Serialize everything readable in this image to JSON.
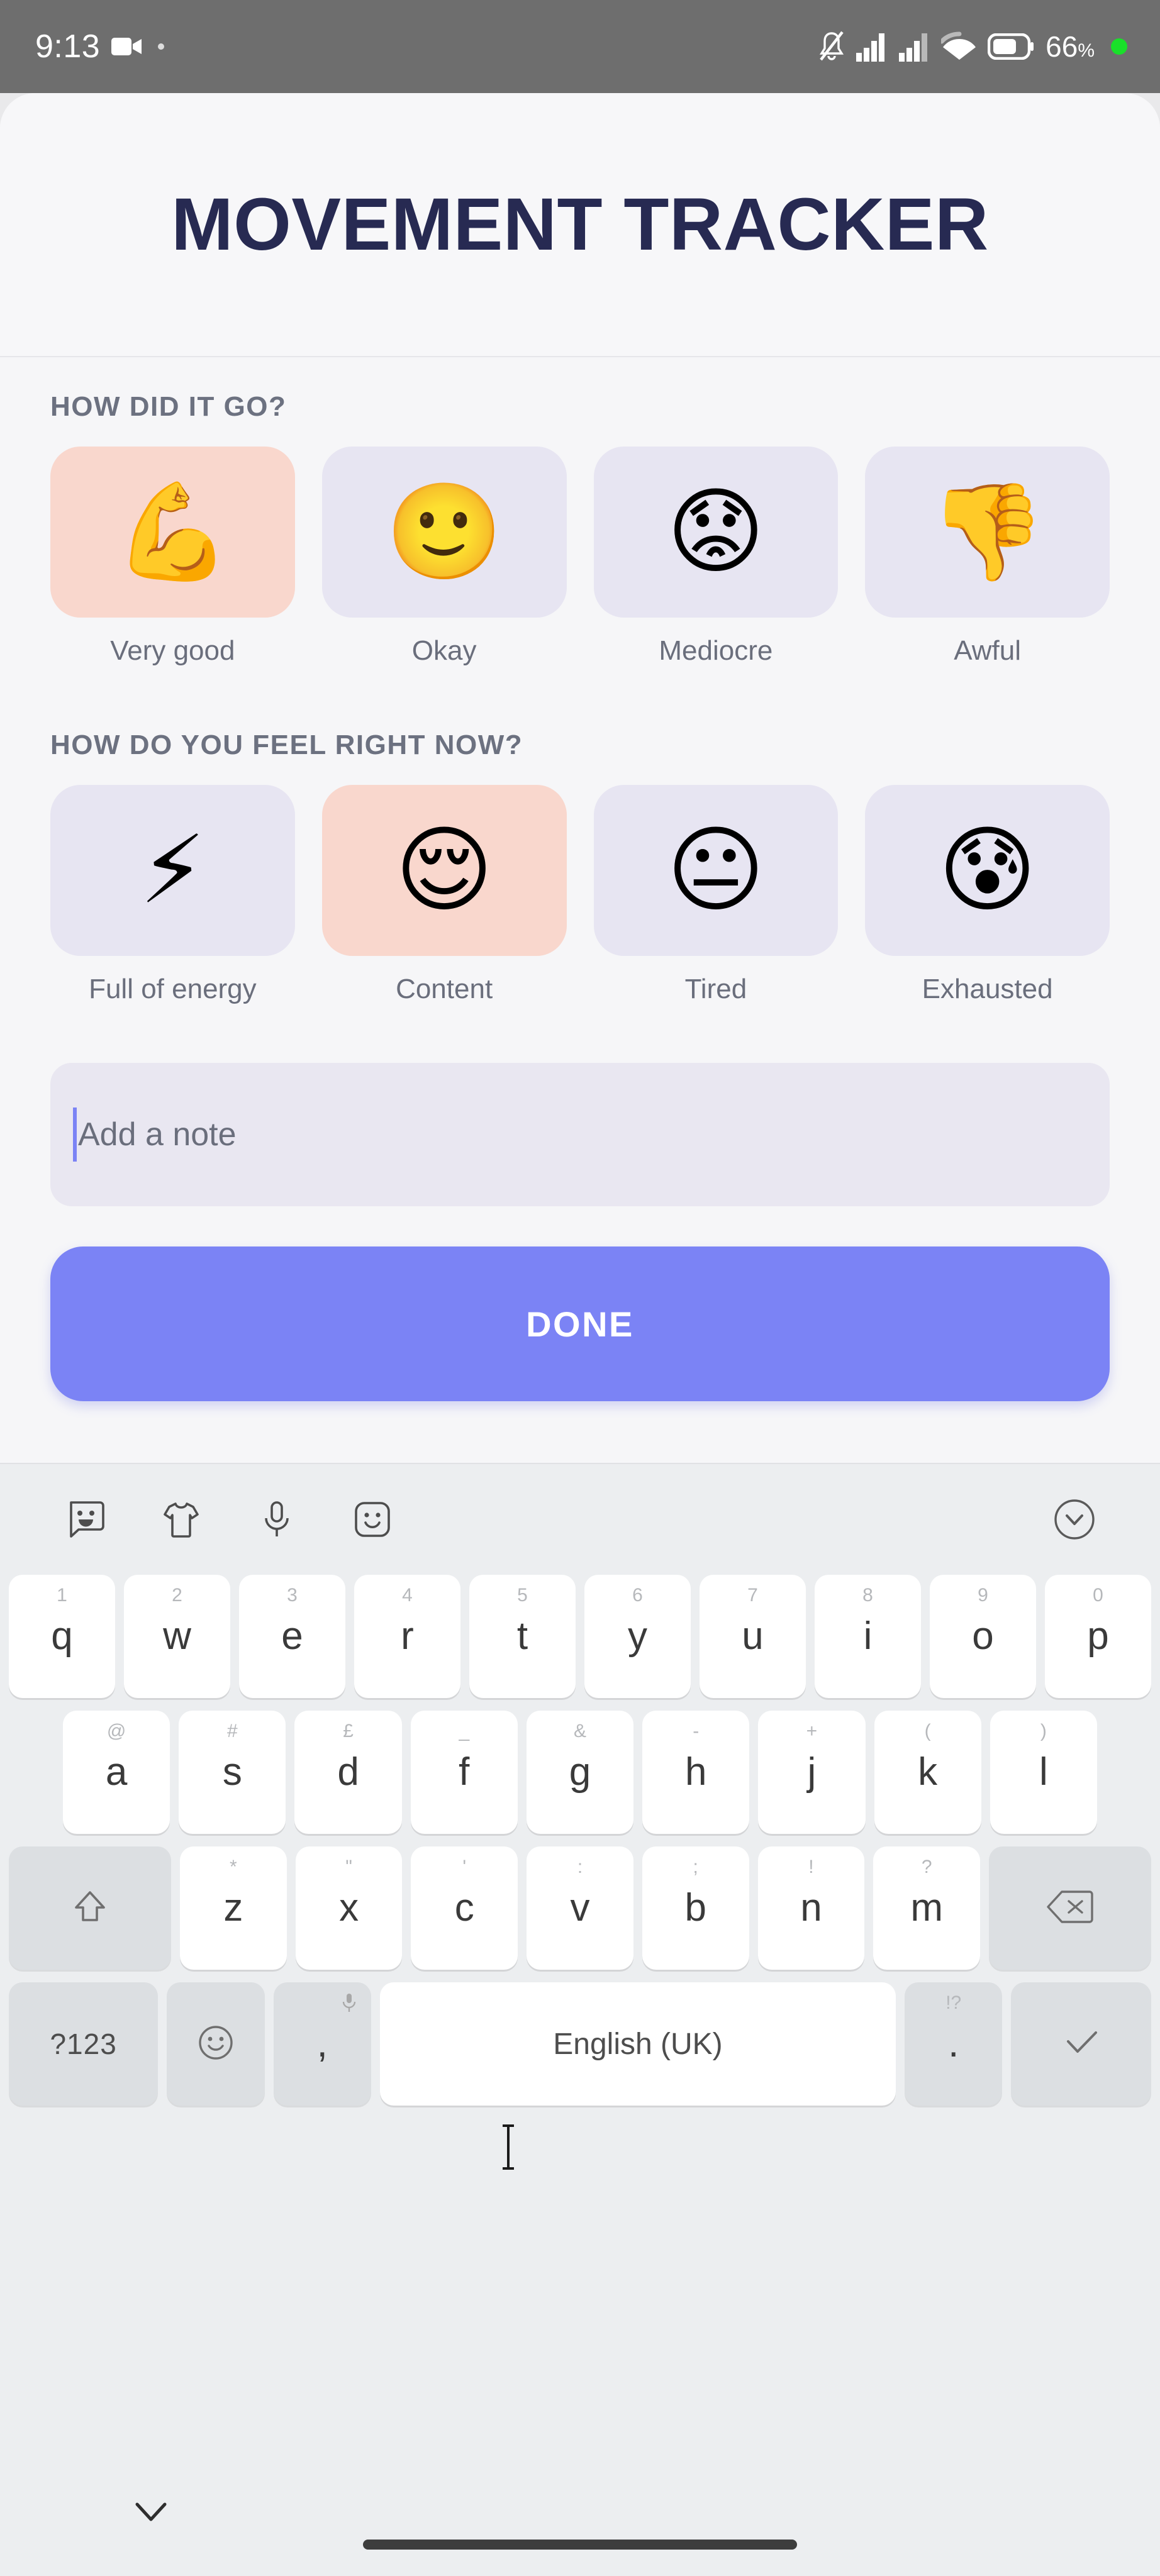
{
  "status_bar": {
    "time": "9:13",
    "battery_text": "66",
    "battery_pct_symbol": "%",
    "icons": [
      "video-record-icon",
      "recording-dot",
      "silent-mode-icon",
      "signal-bars-1-icon",
      "signal-bars-2-icon",
      "wifi-icon",
      "battery-icon",
      "green-status-dot"
    ]
  },
  "header": {
    "title": "MOVEMENT TRACKER",
    "title_color": "#272a52"
  },
  "form": {
    "session_question": {
      "label": "HOW DID IT GO?",
      "options": [
        {
          "label": "Very good",
          "emoji": "💪",
          "icon_name": "flexed-biceps-emoji",
          "selected": true
        },
        {
          "label": "Okay",
          "emoji": "🙂",
          "icon_name": "slightly-smiling-face-emoji",
          "selected": false
        },
        {
          "label": "Mediocre",
          "emoji": "😟",
          "icon_name": "worried-face-emoji",
          "selected": false
        },
        {
          "label": "Awful",
          "emoji": "👎",
          "icon_name": "thumbs-down-emoji",
          "selected": false
        }
      ]
    },
    "feeling_question": {
      "label": "HOW DO YOU FEEL RIGHT NOW?",
      "options": [
        {
          "label": "Full of energy",
          "emoji": "⚡",
          "icon_name": "high-voltage-emoji",
          "selected": false
        },
        {
          "label": "Content",
          "emoji": "😌",
          "icon_name": "relieved-face-emoji",
          "selected": true
        },
        {
          "label": "Tired",
          "emoji": "😐",
          "icon_name": "neutral-face-emoji",
          "selected": false
        },
        {
          "label": "Exhausted",
          "emoji": "😰",
          "icon_name": "anxious-face-with-sweat-emoji",
          "selected": false
        }
      ]
    },
    "note_field": {
      "placeholder": "Add a note",
      "value": "",
      "caret_color": "#7b83f5"
    },
    "submit_button": {
      "label": "DONE",
      "color": "#7b83f5",
      "text_color": "#ffffff"
    }
  },
  "colors": {
    "selected_tile": "#f9d7cd",
    "unselected_tile": "#e7e5f2",
    "accent": "#7b83f5",
    "page_bg": "#f6f6f8",
    "label_text": "#6c7180"
  },
  "keyboard": {
    "toolbar": [
      {
        "icon_name": "sticker-icon"
      },
      {
        "icon_name": "tshirt-theme-icon"
      },
      {
        "icon_name": "microphone-icon"
      },
      {
        "icon_name": "emoji-smiley-icon"
      },
      {
        "icon_name": "chevron-down-circle-icon"
      }
    ],
    "row1": [
      {
        "key": "q",
        "hint": "1"
      },
      {
        "key": "w",
        "hint": "2"
      },
      {
        "key": "e",
        "hint": "3"
      },
      {
        "key": "r",
        "hint": "4"
      },
      {
        "key": "t",
        "hint": "5"
      },
      {
        "key": "y",
        "hint": "6"
      },
      {
        "key": "u",
        "hint": "7"
      },
      {
        "key": "i",
        "hint": "8"
      },
      {
        "key": "o",
        "hint": "9"
      },
      {
        "key": "p",
        "hint": "0"
      }
    ],
    "row2": [
      {
        "key": "a",
        "hint": "@"
      },
      {
        "key": "s",
        "hint": "#"
      },
      {
        "key": "d",
        "hint": "£"
      },
      {
        "key": "f",
        "hint": "_"
      },
      {
        "key": "g",
        "hint": "&"
      },
      {
        "key": "h",
        "hint": "-"
      },
      {
        "key": "j",
        "hint": "+"
      },
      {
        "key": "k",
        "hint": "("
      },
      {
        "key": "l",
        "hint": ")"
      }
    ],
    "row3": [
      {
        "key": "z",
        "hint": "*"
      },
      {
        "key": "x",
        "hint": "\""
      },
      {
        "key": "c",
        "hint": "'"
      },
      {
        "key": "v",
        "hint": ":"
      },
      {
        "key": "b",
        "hint": ";"
      },
      {
        "key": "n",
        "hint": "!"
      },
      {
        "key": "m",
        "hint": "?"
      }
    ],
    "shift_key": {
      "icon_name": "shift-arrow-icon"
    },
    "backspace_key": {
      "icon_name": "backspace-icon"
    },
    "symbols_key": {
      "label": "?123"
    },
    "emoji_key": {
      "icon_name": "emoji-smiley-icon"
    },
    "comma_key": {
      "label": ",",
      "hint_icon_name": "microphone-icon"
    },
    "space_key": {
      "label": "English (UK)"
    },
    "period_key": {
      "label": ".",
      "hint": "!?"
    },
    "enter_key": {
      "icon_name": "checkmark-icon"
    }
  },
  "nav_bar": {
    "hide_keyboard": {
      "icon_name": "chevron-down-icon"
    },
    "home_indicator": {
      "icon_name": "home-gesture-bar"
    }
  }
}
